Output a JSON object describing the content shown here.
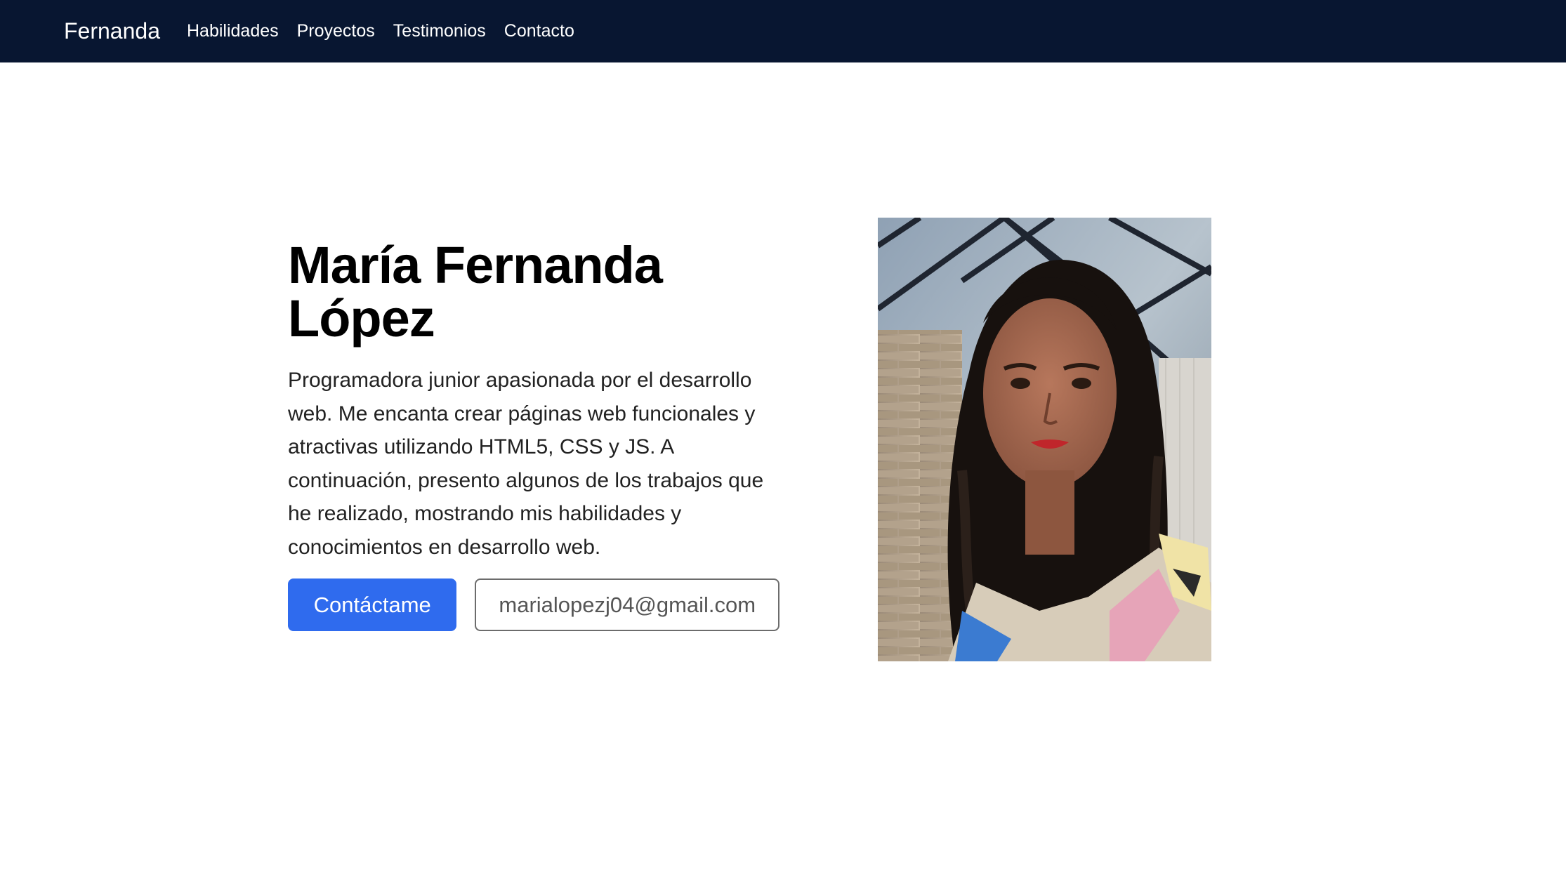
{
  "nav": {
    "brand": "Fernanda",
    "links": [
      "Habilidades",
      "Proyectos",
      "Testimonios",
      "Contacto"
    ]
  },
  "hero": {
    "title_line1": "María Fernanda",
    "title_line2": "López",
    "description": "Programadora junior apasionada por el desarrollo web. Me encanta crear páginas web funcionales y atractivas utilizando HTML5, CSS y JS. A continuación, presento algunos de los trabajos que he realizado, mostrando mis habilidades y conocimientos en desarrollo web.",
    "primary_button": "Contáctame",
    "email_button": "marialopezj04@gmail.com"
  },
  "colors": {
    "navbar_bg": "#081631",
    "primary_button_bg": "#2f6bee"
  }
}
